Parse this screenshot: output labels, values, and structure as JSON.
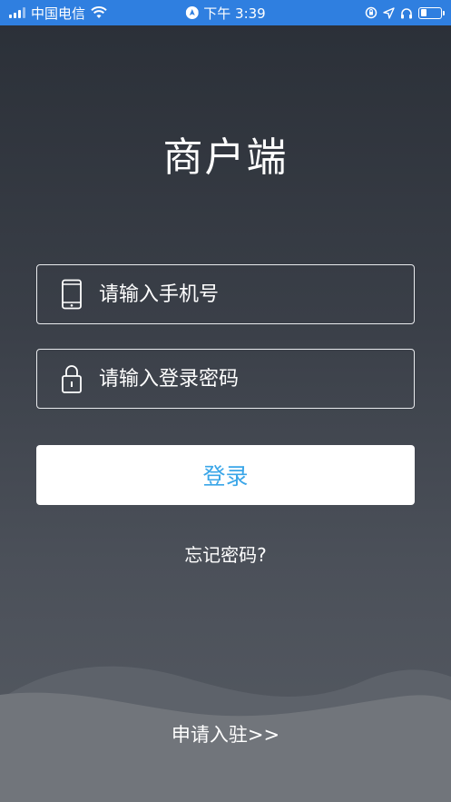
{
  "status_bar": {
    "carrier": "中国电信",
    "time": "下午 3:39"
  },
  "app": {
    "title": "商户端"
  },
  "form": {
    "phone_placeholder": "请输入手机号",
    "password_placeholder": "请输入登录密码",
    "login_label": "登录",
    "forgot_label": "忘记密码?"
  },
  "footer": {
    "apply_label": "申请入驻>>"
  },
  "icons": [
    "signal-icon",
    "wifi-icon",
    "navigation-icon",
    "orientation-lock-icon",
    "location-arrow-icon",
    "headphones-icon",
    "battery-icon",
    "phone-icon",
    "lock-icon"
  ],
  "colors": {
    "status_bar": "#2f7fe0",
    "accent": "#3aa6e8",
    "background": "#2a2f37"
  }
}
